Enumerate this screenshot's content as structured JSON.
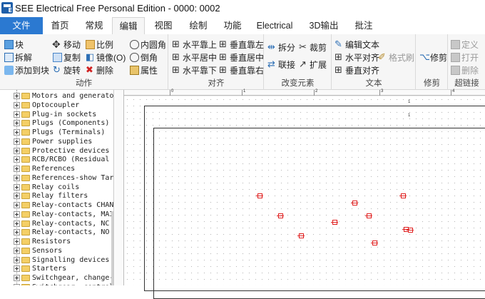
{
  "window": {
    "title": "SEE Electrical Free Personal Edition - 0000: 0002"
  },
  "tabs": [
    {
      "label": "文件"
    },
    {
      "label": "首页"
    },
    {
      "label": "常规"
    },
    {
      "label": "编辑"
    },
    {
      "label": "视图"
    },
    {
      "label": "绘制"
    },
    {
      "label": "功能"
    },
    {
      "label": "Electrical"
    },
    {
      "label": "3D输出"
    },
    {
      "label": "批注"
    }
  ],
  "ribbon": {
    "groups": {
      "action": "动作",
      "align": "对齐",
      "change": "改变元素",
      "text": "文本",
      "modify": "修剪",
      "hyperlink": "超链接"
    },
    "buttons": {
      "block": "块",
      "explode": "拆解",
      "add_to_block": "添加到块",
      "move": "移动",
      "copy": "复制",
      "rotate": "旋转",
      "scale": "比例",
      "mirror": "镜像(O)",
      "delete": "删除",
      "fillet": "内圆角",
      "chamfer": "倒角",
      "properties": "属性",
      "align_top": "水平靠上",
      "align_hcenter": "水平居中",
      "align_bottom": "水平靠下",
      "align_left": "垂直靠左",
      "align_vcenter": "垂直居中",
      "align_right": "垂直靠右",
      "split": "拆分",
      "trim": "裁剪",
      "join": "联接",
      "extend": "扩展",
      "edit_text": "编辑文本",
      "text_halign": "水平对齐",
      "format_brush": "格式刷",
      "text_valign": "垂直对齐",
      "modify": "修剪",
      "define": "定义",
      "open": "打开",
      "link_delete": "删除"
    }
  },
  "tree": {
    "items": [
      "Motors and generato",
      "Optocoupler",
      "Plug-in sockets",
      "Plugs (Components)",
      "Plugs (Terminals)",
      "Power supplies",
      "Protective devices",
      "RCB/RCBO (Residual c",
      "References",
      "References-show Tar",
      "Relay coils",
      "Relay filters",
      "Relay-contacts CHANG",
      "Relay-contacts, MAI",
      "Relay-contacts, NC",
      "Relay-contacts, NO",
      "Resistors",
      "Sensors",
      "Signalling devices",
      "Starters",
      "Switchgear, change-",
      "Switchgear, control"
    ]
  },
  "canvas": {
    "ruler_numbers": [
      "0",
      "1",
      "2",
      "3",
      "4"
    ],
    "frame_numbers": [
      "1",
      "1"
    ]
  },
  "colors": {
    "accent": "#2b79d1",
    "symbol": "#e02020",
    "folder": "#f4cf66"
  }
}
